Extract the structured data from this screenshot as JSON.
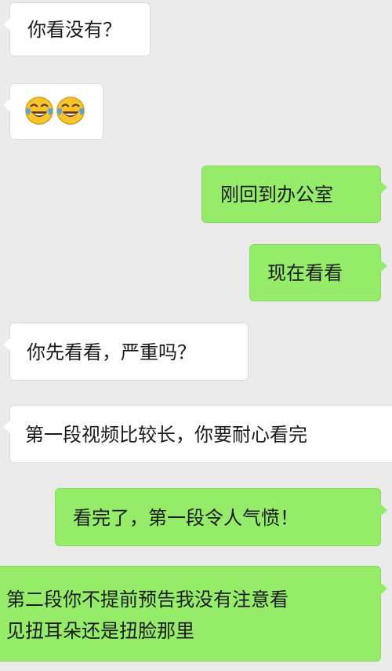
{
  "chat": {
    "messages": [
      {
        "side": "left",
        "text": "你看没有？"
      },
      {
        "side": "left",
        "emoji": [
          "laughing-with-tears-emoji",
          "laughing-with-tears-emoji"
        ]
      },
      {
        "side": "right",
        "text": "刚回到办公室"
      },
      {
        "side": "right",
        "text": "现在看看"
      },
      {
        "side": "left",
        "text": "你先看看，严重吗？"
      },
      {
        "side": "left",
        "text": "第一段视频比较长，你要耐心看完"
      },
      {
        "side": "right",
        "text": "看完了，第一段令人气愤！"
      },
      {
        "side": "right",
        "lines": [
          "第二段你不提前预告我没有注意看",
          "见扭耳朵还是扭脸那里"
        ]
      }
    ]
  },
  "colors": {
    "background": "#ebebeb",
    "incoming_bubble": "#ffffff",
    "outgoing_bubble": "#95ec69"
  }
}
